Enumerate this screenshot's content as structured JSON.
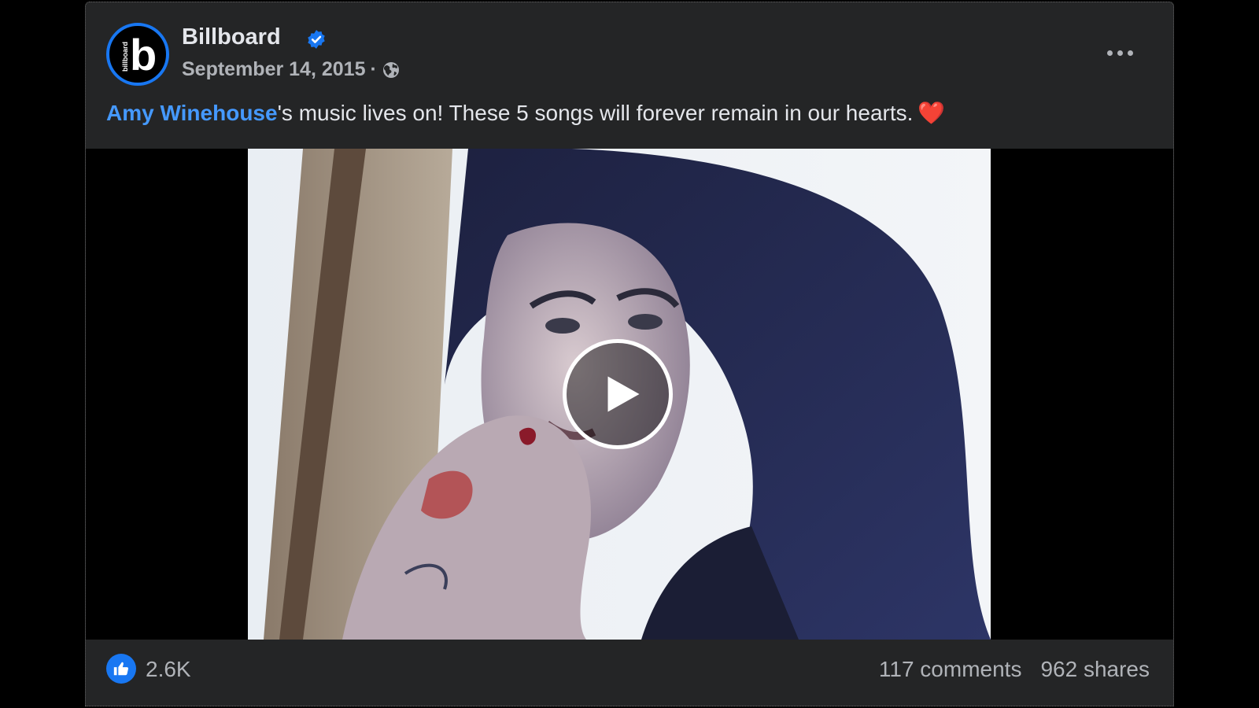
{
  "post": {
    "page_name": "Billboard",
    "verified_icon": "verified-badge-icon",
    "date": "September 14, 2015",
    "separator": "·",
    "privacy_icon": "globe-icon",
    "avatar": {
      "small_text": "billboard",
      "big_text": "b"
    },
    "text": {
      "mention": "Amy Winehouse",
      "body": "'s music lives on! These 5 songs will forever remain in our hearts.",
      "emoji": "❤️"
    },
    "more_icon": "more-options-icon"
  },
  "media": {
    "type": "video",
    "play_icon": "play-icon"
  },
  "footer": {
    "like_icon": "thumbs-up-icon",
    "likes": "2.6K",
    "comments": "117 comments",
    "shares": "962 shares"
  },
  "colors": {
    "card_bg": "#242526",
    "accent": "#1877f2",
    "mention": "#4599ff",
    "secondary_text": "#b0b3b8",
    "primary_text": "#e4e6eb"
  }
}
